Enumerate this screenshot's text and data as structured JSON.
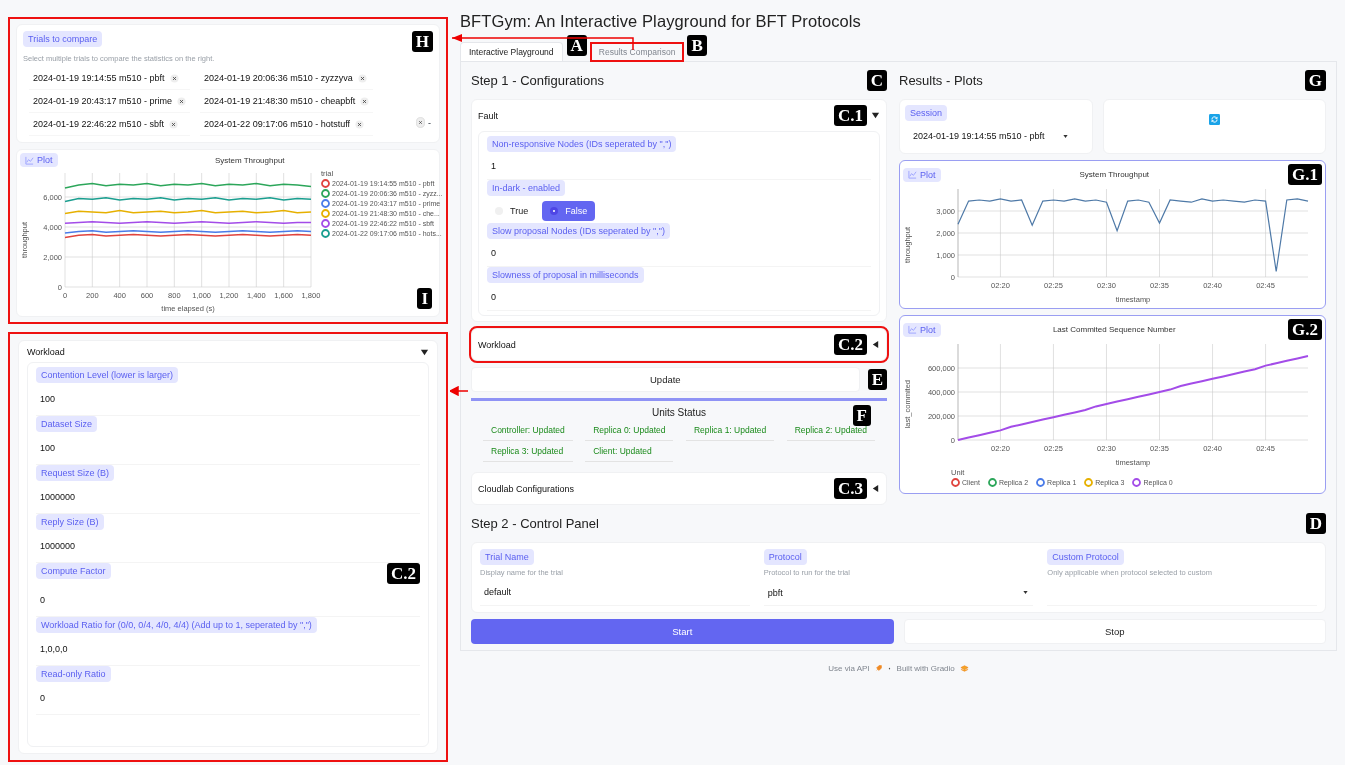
{
  "app_title": "BFTGym: An Interactive Playground for BFT Protocols",
  "tabs": [
    {
      "label": "Interactive Playground",
      "selected": true,
      "callout": "A"
    },
    {
      "label": "Results Comparison",
      "selected": false,
      "callout": "B"
    }
  ],
  "comparison_panel": {
    "callout": "H",
    "label": "Trials to compare",
    "info": "Select multiple trials to compare the statistics on the right.",
    "trials": [
      {
        "label": "2024-01-19 19:14:55 m510 - pbft"
      },
      {
        "label": "2024-01-19 20:06:36 m510 - zyzzyva"
      },
      {
        "label": "2024-01-19 20:43:17 m510 - prime"
      },
      {
        "label": "2024-01-19 21:48:30 m510 - cheapbft"
      },
      {
        "label": "2024-01-19 22:46:22 m510 - sbft"
      },
      {
        "label": "2024-01-22 09:17:06 m510 - hotstuff"
      }
    ],
    "dropdown_mark": "-"
  },
  "comparison_plot": {
    "callout": "I",
    "badge": "Plot",
    "legend_title": "trial",
    "chart_data": {
      "type": "line",
      "title": "System Throughput",
      "xlabel": "time elapsed (s)",
      "ylabel": "throughput",
      "grid": true,
      "x": [
        0,
        100,
        200,
        300,
        400,
        500,
        600,
        700,
        800,
        900,
        1000,
        1100,
        1200,
        1300,
        1400,
        1500,
        1600,
        1700,
        1800
      ],
      "xlim": [
        0,
        1800
      ],
      "ylim": [
        0,
        7600
      ],
      "xticks": [
        0,
        200,
        400,
        600,
        800,
        {
          "value": 1000,
          "label": "1,000"
        },
        {
          "value": 1200,
          "label": "1,200"
        },
        {
          "value": 1400,
          "label": "1,400"
        },
        {
          "value": 1600,
          "label": "1,600"
        },
        {
          "value": 1800,
          "label": "1,800"
        }
      ],
      "yticks": [
        0,
        {
          "value": 2000,
          "label": "2,000"
        },
        {
          "value": 4000,
          "label": "4,000"
        },
        {
          "value": 6000,
          "label": "6,000"
        }
      ],
      "series": [
        {
          "name": "2024-01-19 19:14:55 m510 - pbft",
          "color": "#e0443e",
          "values": [
            3300,
            3450,
            3500,
            3400,
            3450,
            3500,
            3450,
            3400,
            3450,
            3500,
            3450,
            3400,
            3450,
            3500,
            3450,
            3400,
            3450,
            3500,
            3450
          ]
        },
        {
          "name": "2024-01-19 20:06:36 m510 - zyzz...",
          "color": "#2ca65a",
          "values": [
            6600,
            6800,
            6900,
            6750,
            6850,
            6800,
            6900,
            6750,
            6850,
            6800,
            6900,
            6750,
            6850,
            6800,
            6900,
            6750,
            6850,
            6800,
            6700
          ]
        },
        {
          "name": "2024-01-19 20:43:17 m510 - prime",
          "color": "#4a7be8",
          "values": [
            3600,
            3700,
            3750,
            3650,
            3700,
            3750,
            3700,
            3650,
            3700,
            3750,
            3700,
            3650,
            3700,
            3750,
            3700,
            3650,
            3700,
            3750,
            3700
          ]
        },
        {
          "name": "2024-01-19 21:48:30 m510 - che...",
          "color": "#e6b000",
          "values": [
            4900,
            5050,
            5000,
            4950,
            5100,
            4950,
            5000,
            5050,
            4950,
            5000,
            5100,
            4950,
            5000,
            5050,
            4950,
            5000,
            5100,
            4950,
            5000
          ]
        },
        {
          "name": "2024-01-19 22:46:22 m510 - sbft",
          "color": "#a34ce8",
          "values": [
            4250,
            4300,
            4350,
            4300,
            4250,
            4300,
            4350,
            4300,
            4250,
            4300,
            4350,
            4300,
            4250,
            4300,
            4350,
            4300,
            4250,
            4300,
            4300
          ]
        },
        {
          "name": "2024-01-22 09:17:06 m510 - hots...",
          "color": "#1a9e8f",
          "values": [
            5700,
            5900,
            5850,
            5950,
            5800,
            5900,
            5850,
            5950,
            5800,
            5900,
            5850,
            5950,
            5800,
            5900,
            5850,
            5950,
            5800,
            5900,
            5850
          ]
        }
      ]
    }
  },
  "left_workload": {
    "title": "Workload",
    "expanded": true,
    "callout": "C.2",
    "fields": [
      {
        "label": "Contention Level (lower is larger)",
        "value": "100"
      },
      {
        "label": "Dataset Size",
        "value": "100"
      },
      {
        "label": "Request Size (B)",
        "value": "1000000"
      },
      {
        "label": "Reply Size (B)",
        "value": "1000000"
      },
      {
        "label": "Compute Factor",
        "value": "0"
      },
      {
        "label": "Workload Ratio for (0/0, 0/4, 4/0, 4/4) (Add up to 1, seperated by \",\")",
        "value": "1,0,0,0"
      },
      {
        "label": "Read-only Ratio",
        "value": "0"
      }
    ]
  },
  "step1": {
    "title": "Step 1 - Configurations",
    "callout": "C",
    "fault": {
      "title": "Fault",
      "expanded": true,
      "callout": "C.1",
      "fields": [
        {
          "kind": "text",
          "label": "Non-responsive Nodes (IDs seperated by \",\")",
          "value": "1"
        },
        {
          "kind": "radio",
          "label": "In-dark - enabled",
          "options": [
            {
              "label": "True",
              "selected": false
            },
            {
              "label": "False",
              "selected": true
            }
          ]
        },
        {
          "kind": "text",
          "label": "Slow proposal Nodes (IDs seperated by \",\")",
          "value": "0"
        },
        {
          "kind": "text",
          "label": "Slowness of proposal in milliseconds",
          "value": "0"
        }
      ]
    },
    "workload": {
      "title": "Workload",
      "expanded": false,
      "callout": "C.2"
    },
    "update": {
      "label": "Update",
      "callout": "E"
    },
    "units_status": {
      "title": "Units Status",
      "callout": "F",
      "units": [
        {
          "label": "Controller: Updated"
        },
        {
          "label": "Replica 0: Updated"
        },
        {
          "label": "Replica 1: Updated"
        },
        {
          "label": "Replica 2: Updated"
        },
        {
          "label": "Replica 3: Updated"
        },
        {
          "label": "Client: Updated"
        }
      ]
    },
    "cloudlab": {
      "title": "Cloudlab Configurations",
      "expanded": false,
      "callout": "C.3"
    }
  },
  "results": {
    "title": "Results - Plots",
    "callout": "G",
    "session": {
      "label": "Session",
      "value": "2024-01-19 19:14:55 m510 - pbft"
    },
    "plots": [
      {
        "callout": "G.1",
        "badge": "Plot",
        "chart_data": {
          "type": "line",
          "title": "System Throughput",
          "xlabel": "timestamp",
          "ylabel": "throughput",
          "grid": true,
          "categories": [
            null,
            null,
            null,
            null,
            "02:20",
            null,
            null,
            null,
            null,
            "02:25",
            null,
            null,
            null,
            null,
            "02:30",
            null,
            null,
            null,
            null,
            "02:35",
            null,
            null,
            null,
            null,
            "02:40",
            null,
            null,
            null,
            null,
            "02:45",
            null,
            null,
            null,
            null
          ],
          "ylim": [
            0,
            4000
          ],
          "yticks": [
            0,
            {
              "value": 1000,
              "label": "1,000"
            },
            {
              "value": 2000,
              "label": "2,000"
            },
            {
              "value": 3000,
              "label": "3,000"
            }
          ],
          "series": [
            {
              "color": "#4e79a7",
              "values": [
                2400,
                3450,
                3500,
                3450,
                3550,
                3450,
                3500,
                2350,
                3450,
                3500,
                3450,
                3550,
                3450,
                3500,
                3400,
                2100,
                3450,
                3500,
                3400,
                2450,
                3500,
                3450,
                3400,
                3550,
                3450,
                3500,
                3450,
                3400,
                3500,
                3450,
                250,
                3500,
                3550,
                3450
              ]
            }
          ]
        }
      },
      {
        "callout": "G.2",
        "badge": "Plot",
        "legend_title": "Unit",
        "chart_data": {
          "type": "line",
          "title": "Last Commited Sequence Number",
          "xlabel": "timestamp",
          "ylabel": "last_commited",
          "grid": true,
          "categories": [
            null,
            null,
            null,
            null,
            "02:20",
            null,
            null,
            null,
            null,
            "02:25",
            null,
            null,
            null,
            null,
            "02:30",
            null,
            null,
            null,
            null,
            "02:35",
            null,
            null,
            null,
            null,
            "02:40",
            null,
            null,
            null,
            null,
            "02:45",
            null,
            null,
            null,
            null
          ],
          "ylim": [
            0,
            800000
          ],
          "yticks": [
            0,
            {
              "value": 200000,
              "label": "200,000"
            },
            {
              "value": 400000,
              "label": "400,000"
            },
            {
              "value": 600000,
              "label": "600,000"
            }
          ],
          "series": [
            {
              "name": "Client",
              "color": "#e0443e",
              "values": [
                null,
                null,
                null,
                null,
                null,
                null,
                null,
                null,
                null,
                null,
                null,
                null,
                null,
                null,
                null,
                null,
                null,
                null,
                null,
                null,
                null,
                null,
                null,
                null,
                null,
                null,
                null,
                null,
                null,
                null,
                null,
                null,
                null,
                null
              ]
            },
            {
              "name": "Replica 2",
              "color": "#2ca65a",
              "values": [
                null,
                null,
                null,
                null,
                null,
                null,
                null,
                null,
                null,
                null,
                null,
                null,
                null,
                null,
                null,
                null,
                null,
                null,
                null,
                null,
                null,
                null,
                null,
                null,
                null,
                null,
                null,
                null,
                null,
                null,
                null,
                null,
                null,
                null
              ]
            },
            {
              "name": "Replica 1",
              "color": "#4a7be8",
              "values": [
                null,
                null,
                null,
                null,
                null,
                null,
                null,
                null,
                null,
                null,
                null,
                null,
                null,
                null,
                null,
                null,
                null,
                null,
                null,
                null,
                null,
                null,
                null,
                null,
                null,
                null,
                null,
                null,
                null,
                null,
                null,
                null,
                null,
                null
              ]
            },
            {
              "name": "Replica 3",
              "color": "#e6b000",
              "values": [
                null,
                null,
                null,
                null,
                null,
                null,
                null,
                null,
                null,
                null,
                null,
                null,
                null,
                null,
                null,
                null,
                null,
                null,
                null,
                null,
                null,
                null,
                null,
                null,
                null,
                null,
                null,
                null,
                null,
                null,
                null,
                null,
                null,
                null
              ]
            },
            {
              "name": "Replica 0",
              "color": "#a34ce8",
              "values": [
                0,
                20000,
                40000,
                60000,
                80000,
                110000,
                130000,
                150000,
                170000,
                190000,
                210000,
                230000,
                250000,
                280000,
                300000,
                320000,
                340000,
                360000,
                380000,
                400000,
                420000,
                450000,
                470000,
                490000,
                510000,
                530000,
                550000,
                570000,
                590000,
                620000,
                640000,
                660000,
                680000,
                700000
              ]
            }
          ]
        }
      }
    ]
  },
  "step2": {
    "title": "Step 2 - Control Panel",
    "callout": "D",
    "fields": [
      {
        "kind": "text",
        "label": "Trial Name",
        "info": "Display name for the trial",
        "value": "default"
      },
      {
        "kind": "dropdown",
        "label": "Protocol",
        "info": "Protocol to run for the trial",
        "value": "pbft"
      },
      {
        "kind": "text",
        "label": "Custom Protocol",
        "info": "Only applicable when protocol selected to custom"
      }
    ],
    "buttons": [
      {
        "label": "Start",
        "kind": "primary"
      },
      {
        "label": "Stop",
        "kind": "secondary"
      }
    ]
  },
  "footer": {
    "api": "Use via API",
    "separator": "·",
    "built": "Built with Gradio"
  }
}
